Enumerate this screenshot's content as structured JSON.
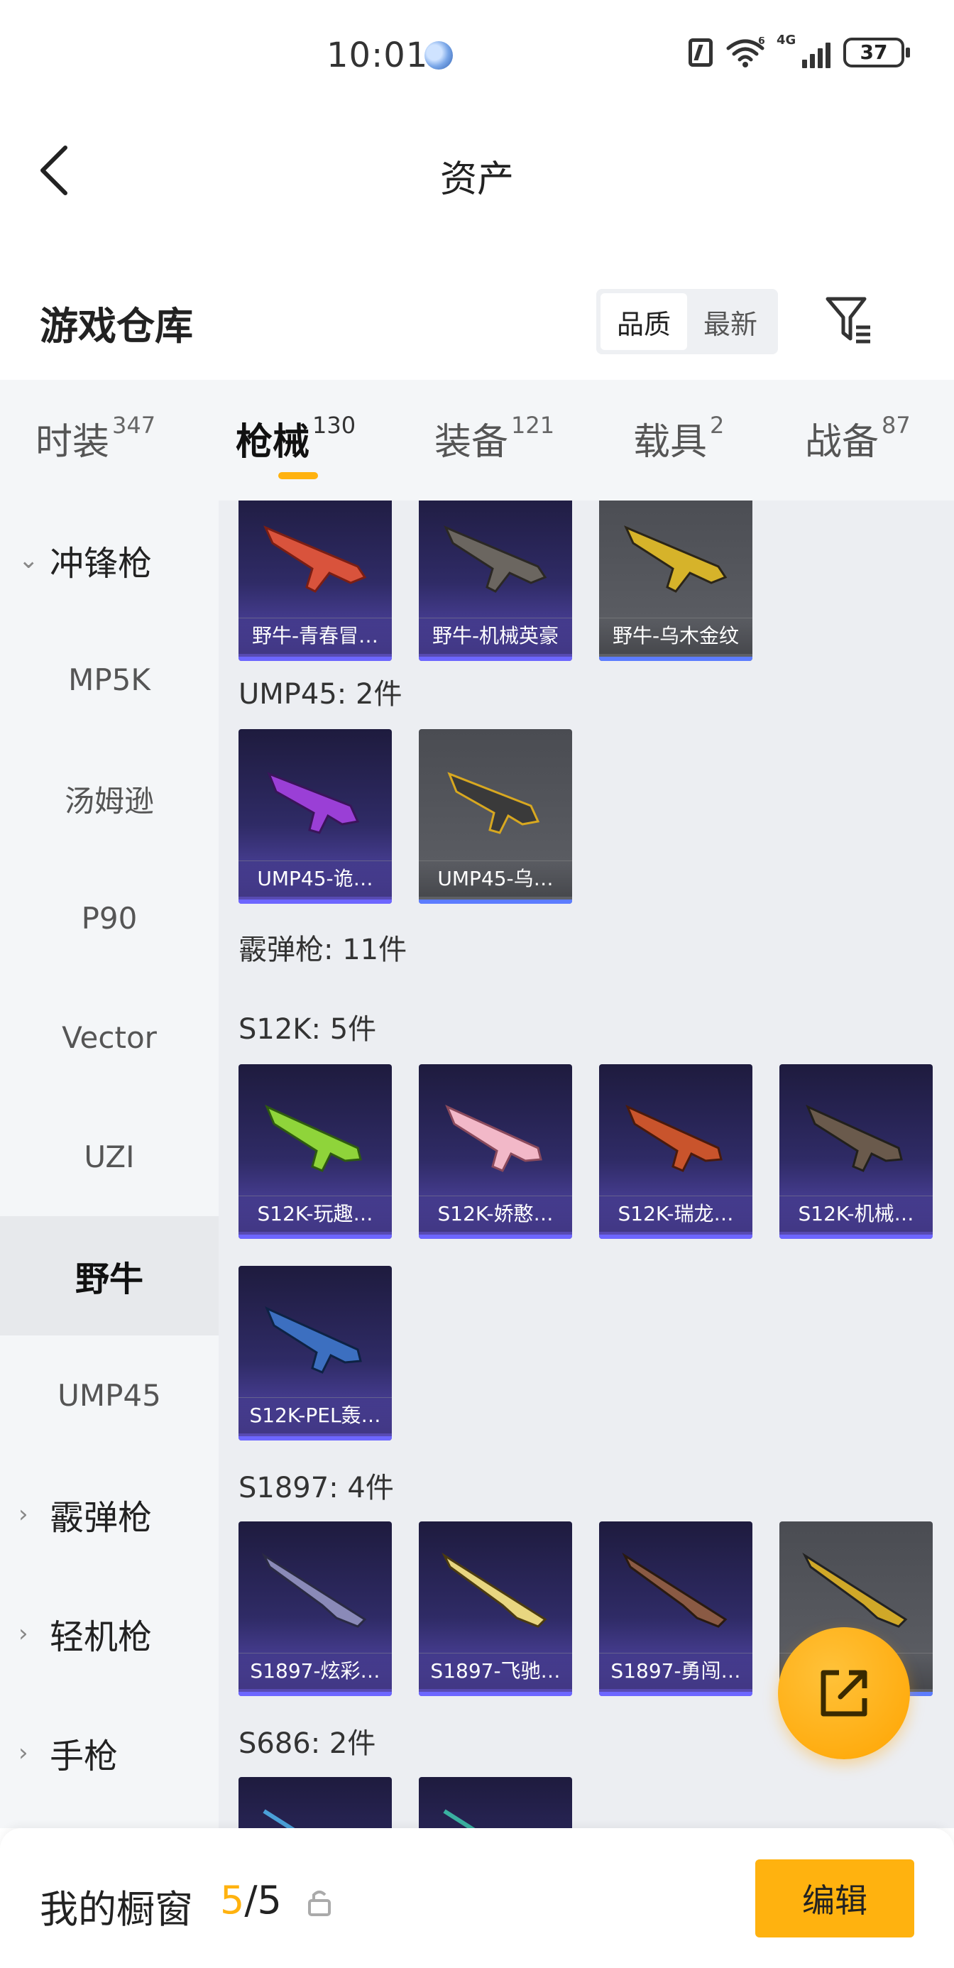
{
  "status_bar": {
    "time": "10:01",
    "network_label": "4G",
    "wifi_label": "6",
    "battery": "37"
  },
  "header": {
    "title": "资产"
  },
  "warehouse": {
    "title": "游戏仓库",
    "sort_options": [
      "品质",
      "最新"
    ],
    "active_sort": "品质"
  },
  "tabs": [
    {
      "label": "时装",
      "count": "347"
    },
    {
      "label": "枪械",
      "count": "130",
      "active": true
    },
    {
      "label": "装备",
      "count": "121"
    },
    {
      "label": "载具",
      "count": "2"
    },
    {
      "label": "战备",
      "count": "87"
    }
  ],
  "sidebar": [
    {
      "label": "冲锋枪",
      "type": "group",
      "expanded": true
    },
    {
      "label": "MP5K"
    },
    {
      "label": "汤姆逊"
    },
    {
      "label": "P90"
    },
    {
      "label": "Vector"
    },
    {
      "label": "UZI"
    },
    {
      "label": "野牛",
      "active": true
    },
    {
      "label": "UMP45"
    },
    {
      "label": "霰弹枪",
      "type": "group"
    },
    {
      "label": "轻机枪",
      "type": "group"
    },
    {
      "label": "手枪",
      "type": "group"
    }
  ],
  "content": {
    "top_cards": [
      "野牛-青春冒…",
      "野牛-机械英豪",
      "野牛-乌木金纹"
    ],
    "ump_label": "UMP45: 2件",
    "ump_cards": [
      "UMP45-诡…",
      "UMP45-乌…"
    ],
    "shotgun_label": "霰弹枪: 11件",
    "s12k_label": "S12K: 5件",
    "s12k_cards": [
      "S12K-玩趣…",
      "S12K-娇憨…",
      "S12K-瑞龙…",
      "S12K-机械…",
      "S12K-PEL轰…"
    ],
    "s1897_label": "S1897: 4件",
    "s1897_cards": [
      "S1897-炫彩…",
      "S1897-飞驰…",
      "S1897-勇闯…",
      "…"
    ],
    "s686_label": "S686: 2件"
  },
  "showcase": {
    "title": "我的橱窗",
    "current": "5",
    "total": "/5",
    "edit_label": "编辑"
  },
  "colors": {
    "accent": "#ffb20f",
    "card_bar": "#6d66ff"
  }
}
